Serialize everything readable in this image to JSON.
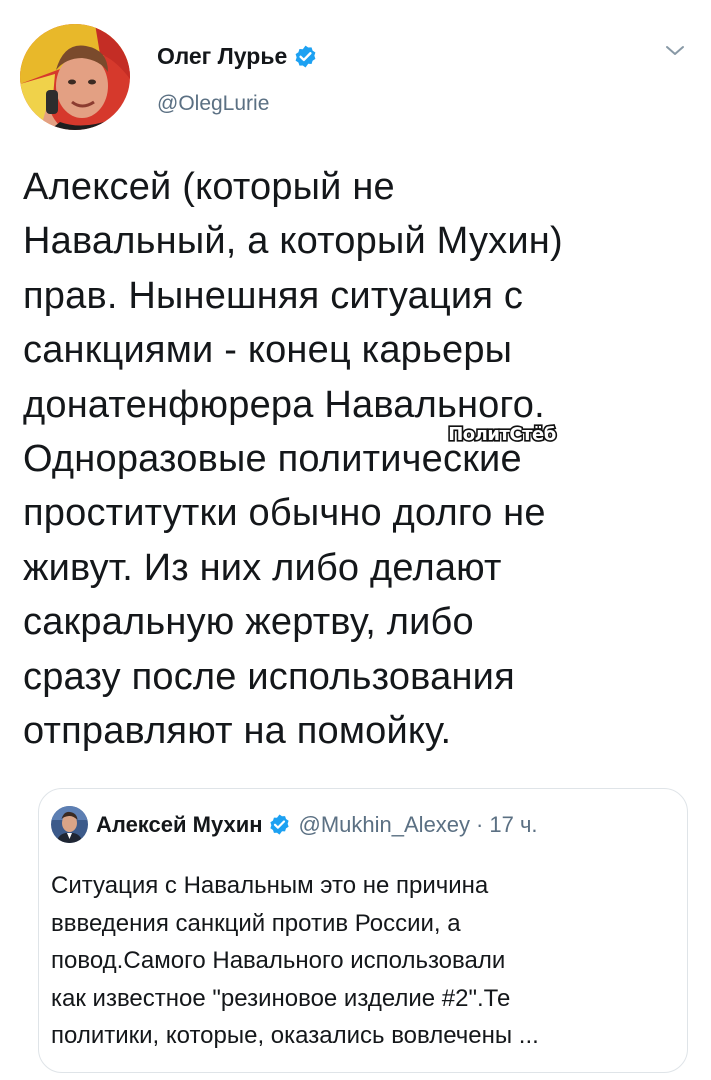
{
  "author": {
    "name": "Олег Лурье",
    "handle": "@OlegLurie"
  },
  "tweet": {
    "text": "Алексей (который не\nНавальный, а который Мухин)\nправ. Нынешняя ситуация с\nсанкциями - конец карьеры\nдонатенфюрера Навального.\nОдноразовые политические\nпроститутки обычно долго не\nживут. Из них либо делают\nсакральную жертву, либо\nсразу после использования\nотправляют на помойку."
  },
  "watermark": {
    "text": "ПолитСтёб"
  },
  "quoted_tweet": {
    "author_name": "Алексей Мухин",
    "handle": "@Mukhin_Alexey",
    "separator": "·",
    "time": "17 ч.",
    "text": "Ситуация с Навальным это не причина\nввведения санкций против России, а\nповод.Самого Навального использовали\nкак известное \"резиновое изделие #2\".Те\nполитики, которые, оказались вовлечены ..."
  },
  "icons": {
    "verified": "verified-badge-icon",
    "menu": "chevron-down-icon"
  },
  "colors": {
    "verified": "#1da1f2",
    "secondary_text": "#5b7083",
    "primary_text": "#14171a",
    "border": "#dfe4e8"
  }
}
